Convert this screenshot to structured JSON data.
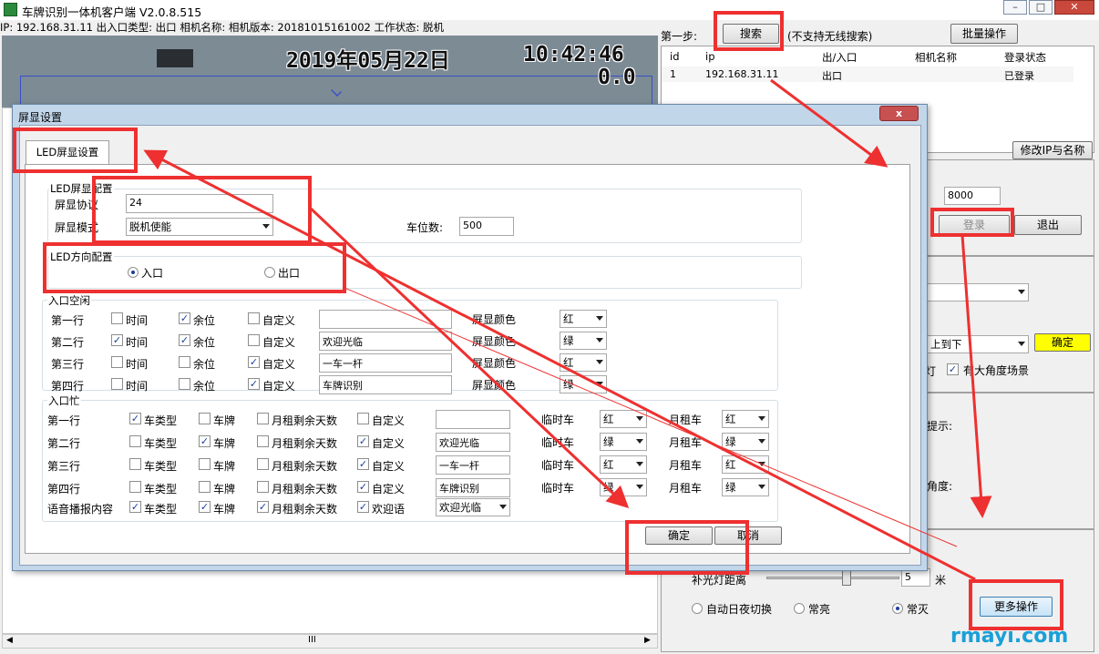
{
  "app": {
    "title": "车牌识别一体机客户端 V2.0.8.515",
    "info": "IP: 192.168.31.11  出入口类型: 出口  相机名称:  相机版本: 20181015161002  工作状态: 脱机"
  },
  "video": {
    "date": "2019年05月22日",
    "time": "10:42:46",
    "counter": "0.0"
  },
  "right": {
    "step_label": "第一步:",
    "search": "搜索",
    "hint": "(不支持无线搜索)",
    "batch": "批量操作",
    "table_headers": [
      "id",
      "ip",
      "出/入口",
      "相机名称",
      "登录状态"
    ],
    "row": [
      "1",
      "192.168.31.11",
      "出口",
      "",
      "已登录"
    ],
    "modify_ip": "修改IP与名称",
    "port": "8000",
    "login": "登录",
    "logout": "退出",
    "dir_value": "上到下",
    "confirm_yellow": "确定",
    "light_label": "灯",
    "angle_label": "有大角度场景",
    "tip_label": "提示:",
    "angle2_label": "角度:",
    "fill_light": "补光灯距离",
    "fill_value": "5",
    "unit_m": "米",
    "auto_switch": "自动日夜切换",
    "always_on": "常亮",
    "always_off": "常灭",
    "more_ops": "更多操作",
    "watermark": "rmayi.com"
  },
  "dialog": {
    "title": "屏显设置",
    "close": "x",
    "tab": "LED屏显设置",
    "g1_title": "LED屏显配置",
    "proto_label": "屏显协议",
    "proto_value": "24",
    "mode_label": "屏显模式",
    "mode_value": "脱机使能",
    "spaces_label": "车位数:",
    "spaces_value": "500",
    "g2_title": "LED方向配置",
    "dir_in": "入口",
    "dir_out": "出口",
    "idle_title": "入口空闲",
    "idle_col": [
      "时间",
      "余位",
      "自定义"
    ],
    "color_label": "屏显颜色",
    "idle_rows": [
      {
        "label": "第一行",
        "custom": "",
        "color": "红"
      },
      {
        "label": "第二行",
        "custom": "欢迎光临",
        "color": "绿"
      },
      {
        "label": "第三行",
        "custom": "一车一杆",
        "color": "红"
      },
      {
        "label": "第四行",
        "custom": "车牌识别",
        "color": "绿"
      }
    ],
    "busy_title": "入口忙",
    "busy_col": [
      "车类型",
      "车牌",
      "月租剩余天数",
      "自定义"
    ],
    "temp_label": "临时车",
    "month_label": "月租车",
    "busy_rows": [
      {
        "label": "第一行",
        "custom": "",
        "temp": "红",
        "month": "红"
      },
      {
        "label": "第二行",
        "custom": "欢迎光临",
        "temp": "绿",
        "month": "绿"
      },
      {
        "label": "第三行",
        "custom": "一车一杆",
        "temp": "红",
        "month": "红"
      },
      {
        "label": "第四行",
        "custom": "车牌识别",
        "temp": "绿",
        "month": "绿"
      }
    ],
    "voice_label": "语音播报内容",
    "voice_last": "欢迎语",
    "voice_value": "欢迎光临",
    "ok": "确定",
    "cancel": "取消"
  },
  "bottom": {
    "scroll_mid": "III"
  },
  "colors": {
    "annotation": "#ee3030",
    "highlight": "#ffff00"
  }
}
